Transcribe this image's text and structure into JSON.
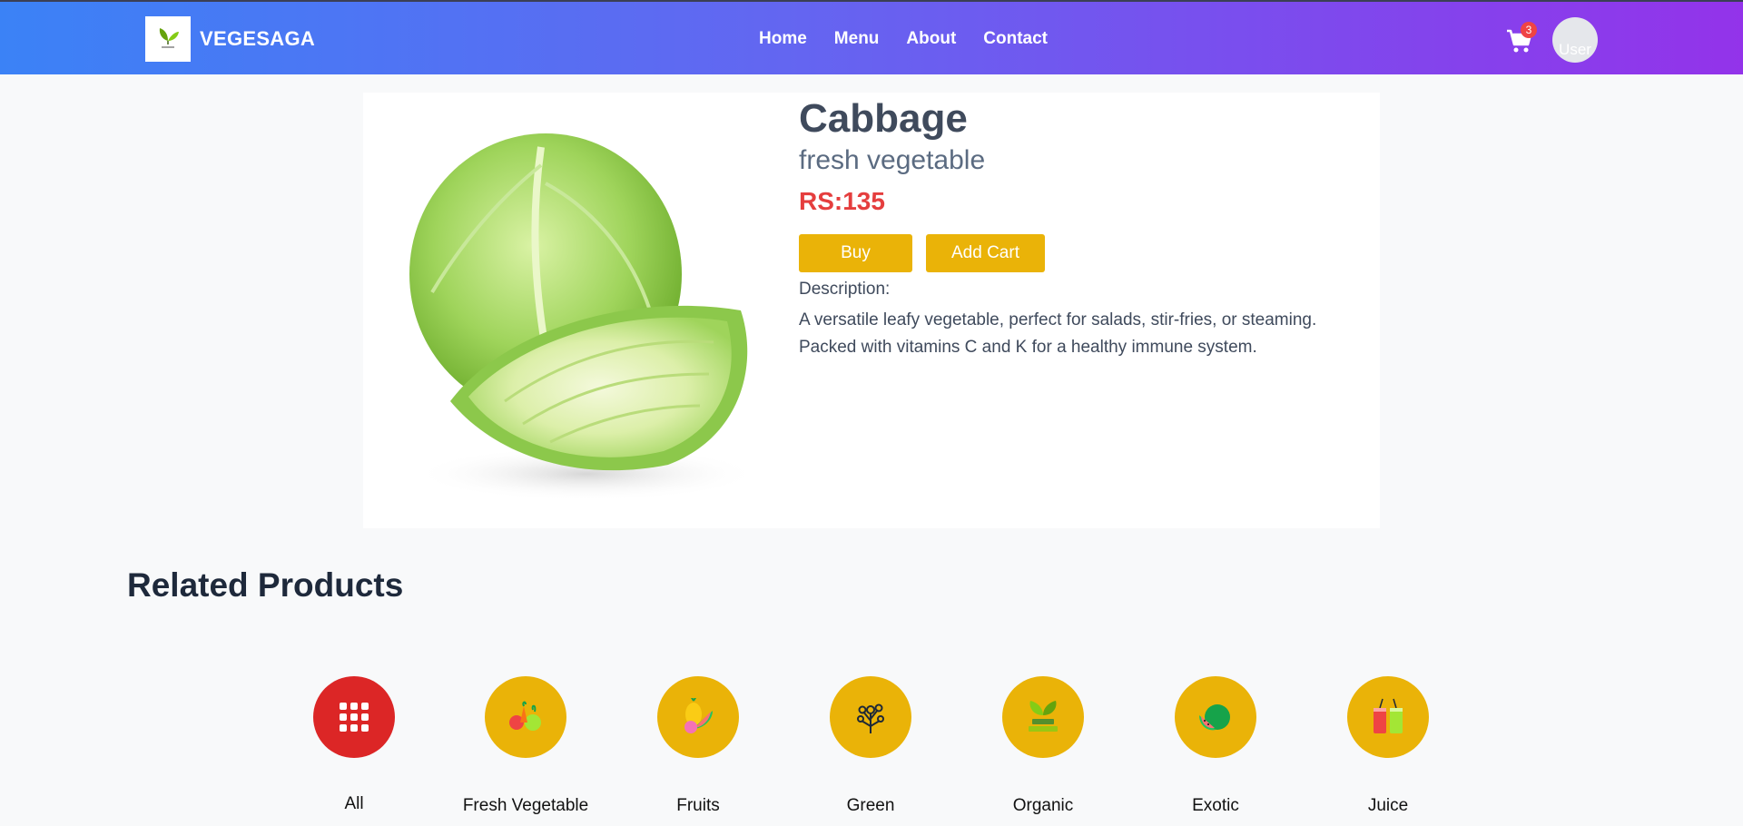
{
  "nav": {
    "brand": "VEGESAGA",
    "links": [
      "Home",
      "Menu",
      "About",
      "Contact"
    ],
    "cart_count": "3",
    "avatar_alt": "User"
  },
  "product": {
    "title": "Cabbage",
    "subtitle": "fresh vegetable",
    "price": "RS:135",
    "buy_label": "Buy",
    "add_cart_label": "Add Cart",
    "description_label": "Description:",
    "description": "A versatile leafy vegetable, perfect for salads, stir-fries, or steaming. Packed with vitamins C and K for a healthy immune system."
  },
  "related": {
    "title": "Related Products",
    "categories": [
      {
        "label": "All",
        "icon": "grid-icon"
      },
      {
        "label": "Fresh Vegetable",
        "icon": "vegetables-icon"
      },
      {
        "label": "Fruits",
        "icon": "fruits-icon"
      },
      {
        "label": "Green",
        "icon": "greens-icon"
      },
      {
        "label": "Organic",
        "icon": "organic-icon"
      },
      {
        "label": "Exotic",
        "icon": "watermelon-icon"
      },
      {
        "label": "Juice",
        "icon": "juice-icon"
      }
    ]
  },
  "colors": {
    "accent": "#eab308",
    "active": "#dc2626",
    "price": "#e53e3e",
    "nav_start": "#3b82f6",
    "nav_end": "#9333ea"
  }
}
